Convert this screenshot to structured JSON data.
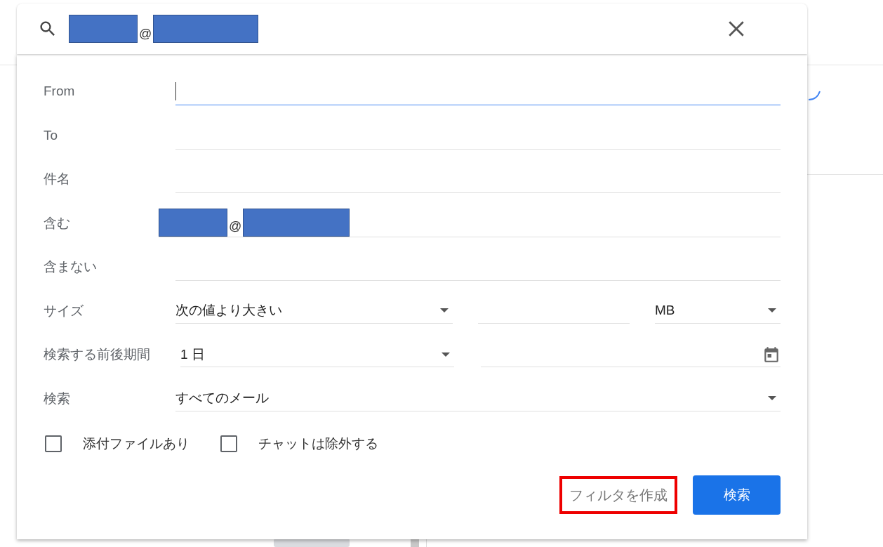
{
  "search": {
    "query_parts": [
      {
        "kind": "redacted"
      },
      {
        "kind": "text",
        "text": "@"
      },
      {
        "kind": "redacted"
      }
    ]
  },
  "rows": [
    {
      "kind": "text",
      "label": "From",
      "focused": true
    },
    {
      "kind": "text",
      "label": "To",
      "focused": false
    },
    {
      "kind": "text",
      "label": "件名",
      "focused": false
    },
    {
      "kind": "text",
      "label": "含む",
      "focused": false,
      "value_parts": [
        {
          "kind": "redacted"
        },
        {
          "kind": "text",
          "text": "@"
        },
        {
          "kind": "redacted"
        }
      ]
    },
    {
      "kind": "text",
      "label": "含まない",
      "focused": false
    },
    {
      "kind": "size",
      "label": "サイズ",
      "comparison": "次の値より大きい",
      "unit": "MB"
    },
    {
      "kind": "date",
      "label": "検索する前後期間",
      "range": "1 日"
    },
    {
      "kind": "select",
      "label": "検索",
      "value": "すべてのメール"
    }
  ],
  "checkboxes": [
    {
      "label": "添付ファイルあり",
      "checked": false
    },
    {
      "label": "チャットは除外する",
      "checked": false
    }
  ],
  "create_filter": {
    "label": "フィルタを作成",
    "highlighted": true
  },
  "search_button": {
    "label": "検索"
  }
}
